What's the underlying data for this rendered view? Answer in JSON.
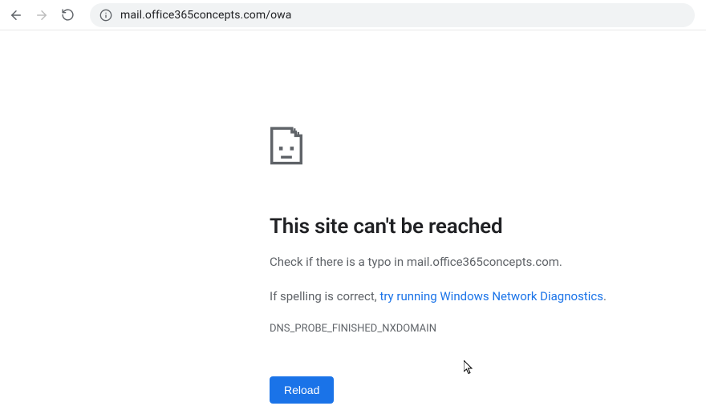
{
  "browser": {
    "url": "mail.office365concepts.com/owa"
  },
  "error": {
    "title": "This site can't be reached",
    "subtitle_prefix": "Check if there is a typo in ",
    "subtitle_domain": "mail.office365concepts.com.",
    "suggestion_prefix": "If spelling is correct, ",
    "diagnostics_link": "try running Windows Network Diagnostics",
    "suggestion_suffix": ".",
    "code": "DNS_PROBE_FINISHED_NXDOMAIN",
    "reload_label": "Reload"
  }
}
